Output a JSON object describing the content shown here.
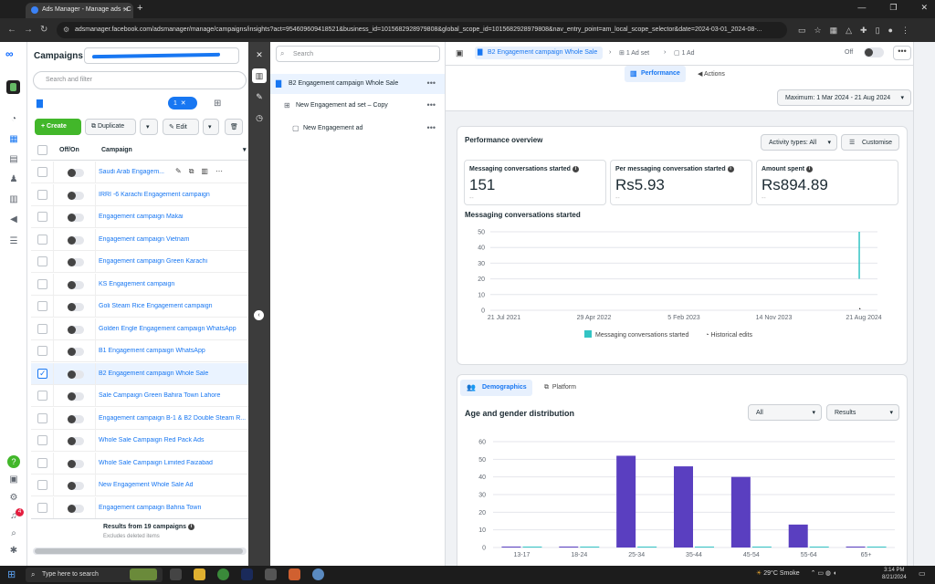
{
  "browser": {
    "tab_title": "Ads Manager - Manage ads - C",
    "url": "adsmanager.facebook.com/adsmanager/manage/campaigns/insights?act=954609609418521&business_id=1015682928979808&global_scope_id=1015682928979808&nav_entry_point=am_local_scope_selector&date=2024-03-01_2024-08-..."
  },
  "left": {
    "title": "Campaigns",
    "search_placeholder": "Search and filter",
    "selected_count": "1",
    "toolbar": {
      "create": "Create",
      "duplicate": "Duplicate",
      "edit": "Edit"
    },
    "columns": {
      "offon": "Off/On",
      "campaign": "Campaign"
    },
    "campaigns": [
      {
        "name": "Saudi Arab Engagem..."
      },
      {
        "name": "IRRI -6 Karachi Engagement campaign"
      },
      {
        "name": "Engagement campaign Makai"
      },
      {
        "name": "Engagement campaign Vietnam"
      },
      {
        "name": "Engagement campaign Green Karachi"
      },
      {
        "name": "KS Engagement campaign"
      },
      {
        "name": "Goli Steam Rice Engagement campaign"
      },
      {
        "name": "Golden Engle Engagement campaign WhatsApp"
      },
      {
        "name": "B1 Engagement campaign WhatsApp"
      },
      {
        "name": "B2 Engagement campaign Whole Sale",
        "selected": true
      },
      {
        "name": "Sale Campaign Green Bahira Town Lahore"
      },
      {
        "name": "Engagement campaign B-1 & B2 Double Steam R..."
      },
      {
        "name": "Whole Sale Campaign Red Pack Ads"
      },
      {
        "name": "Whole Sale Campaign Limited Faizabad"
      },
      {
        "name": "New Engagement Whole Sale Ad"
      },
      {
        "name": "Engagement campaign Bahria Town"
      }
    ],
    "footer_results": "Results from 19 campaigns",
    "footer_note": "Excludes deleted items",
    "notif_count": "4"
  },
  "tree": {
    "search_placeholder": "Search",
    "items": [
      {
        "label": "B2 Engagement campaign Whole Sale"
      },
      {
        "label": "New Engagement ad set – Copy"
      },
      {
        "label": "New Engagement ad"
      }
    ]
  },
  "right": {
    "breadcrumb": {
      "campaign": "B2 Engagement campaign Whole Sale",
      "adset": "1 Ad set",
      "ad": "1 Ad"
    },
    "status_label": "Off",
    "tabs": {
      "performance": "Performance",
      "actions": "Actions"
    },
    "date_range": "Maximum: 1 Mar 2024 - 21 Aug 2024",
    "overview": {
      "title": "Performance overview",
      "activity_types": "Activity types: All",
      "customise": "Customise",
      "metrics": [
        {
          "label": "Messaging conversations started",
          "value": "151",
          "sub": "--"
        },
        {
          "label": "Per messaging conversation started",
          "value": "Rs5.93",
          "sub": "--"
        },
        {
          "label": "Amount spent",
          "value": "Rs894.89",
          "sub": "--"
        }
      ]
    },
    "demographics": {
      "tab_demographics": "Demographics",
      "tab_platform": "Platform",
      "title": "Age and gender distribution",
      "filter1": "All",
      "filter2": "Results"
    }
  },
  "chart_data": [
    {
      "type": "line",
      "title": "Messaging conversations started",
      "x_ticks": [
        "21 Jul 2021",
        "29 Apr 2022",
        "5 Feb 2023",
        "14 Nov 2023",
        "21 Aug 2024"
      ],
      "ylim": [
        0,
        50
      ],
      "y_ticks": [
        0,
        10,
        20,
        30,
        40,
        50
      ],
      "series": [
        {
          "name": "Messaging conversations started",
          "color": "#33c4c4",
          "spike_at_fraction_of_range": 0.96,
          "spike_range": [
            20,
            50
          ]
        }
      ],
      "legend": [
        "Messaging conversations started",
        "Historical edits"
      ],
      "grid": true
    },
    {
      "type": "bar",
      "categories": [
        "13-17",
        "18-24",
        "25-34",
        "35-44",
        "45-54",
        "55-64",
        "65+"
      ],
      "ylim": [
        0,
        60
      ],
      "y_ticks": [
        0,
        10,
        20,
        30,
        40,
        50,
        60
      ],
      "series": [
        {
          "values": [
            0,
            0,
            52,
            46,
            40,
            13,
            0
          ],
          "color": "#5a3fc0"
        },
        {
          "values": [
            0,
            0,
            0,
            0,
            0,
            0,
            0
          ],
          "color": "#33c4c4"
        }
      ],
      "grid": true
    }
  ],
  "taskbar": {
    "search": "Type here to search",
    "weather": "29°C  Smoke",
    "time": "3:14 PM",
    "date": "8/21/2024"
  }
}
